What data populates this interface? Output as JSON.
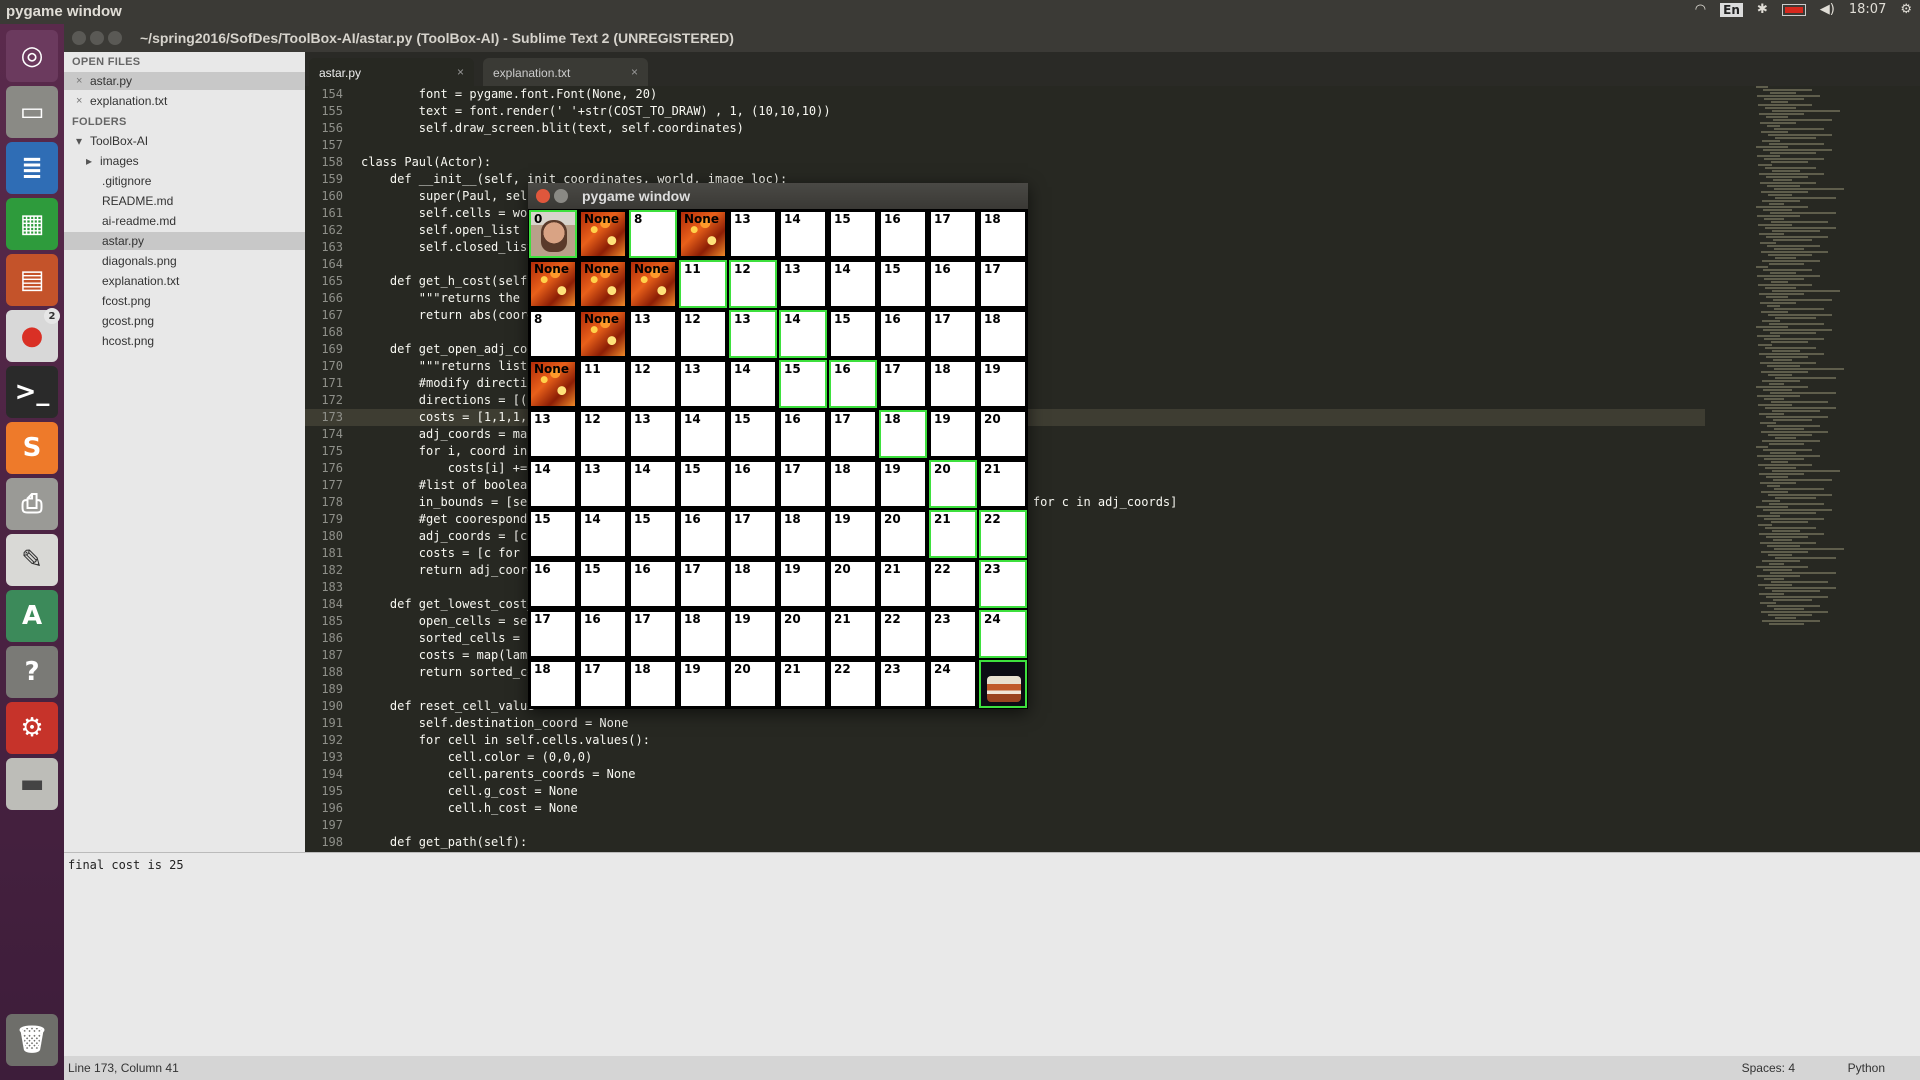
{
  "topbar": {
    "title": "pygame window",
    "lang": "En",
    "time": "18:07"
  },
  "launcher": {
    "chrome_badge": "2"
  },
  "window": {
    "title": "~/spring2016/SofDes/ToolBox-AI/astar.py (ToolBox-AI) - Sublime Text 2 (UNREGISTERED)"
  },
  "sidebar": {
    "open_files_header": "OPEN FILES",
    "open_files": [
      "astar.py",
      "explanation.txt"
    ],
    "folders_header": "FOLDERS",
    "root": "ToolBox-AI",
    "items": [
      "images",
      ".gitignore",
      "README.md",
      "ai-readme.md",
      "astar.py",
      "diagonals.png",
      "explanation.txt",
      "fcost.png",
      "gcost.png",
      "hcost.png"
    ]
  },
  "tabs": [
    {
      "label": "astar.py",
      "close": "×"
    },
    {
      "label": "explanation.txt",
      "close": "×"
    }
  ],
  "code": {
    "lines": [
      {
        "n": "154",
        "t": "        font = pygame.font.Font(None, 20)"
      },
      {
        "n": "155",
        "t": "        text = font.render(' '+str(COST_TO_DRAW) , 1, (10,10,10))"
      },
      {
        "n": "156",
        "t": "        self.draw_screen.blit(text, self.coordinates)"
      },
      {
        "n": "157",
        "t": ""
      },
      {
        "n": "158",
        "t": "class Paul(Actor):"
      },
      {
        "n": "159",
        "t": "    def __init__(self, init_coordinates, world, image_loc):"
      },
      {
        "n": "160",
        "t": "        super(Paul, self"
      },
      {
        "n": "161",
        "t": "        self.cells = wor"
      },
      {
        "n": "162",
        "t": "        self.open_list"
      },
      {
        "n": "163",
        "t": "        self.closed_list"
      },
      {
        "n": "164",
        "t": ""
      },
      {
        "n": "165",
        "t": "    def get_h_cost(self,"
      },
      {
        "n": "166",
        "t": "        \"\"\"returns the h"
      },
      {
        "n": "167",
        "t": "        return abs(coord"
      },
      {
        "n": "168",
        "t": ""
      },
      {
        "n": "169",
        "t": "    def get_open_adj_coo"
      },
      {
        "n": "170",
        "t": "        \"\"\"returns list                                                      closed list.\"\"\""
      },
      {
        "n": "171",
        "t": "        #modify directic"
      },
      {
        "n": "172",
        "t": "        directions = [(1                                                     (0,-2)]"
      },
      {
        "n": "173",
        "t": "        costs = [1,1,1,1"
      },
      {
        "n": "174",
        "t": "        adj_coords = map"
      },
      {
        "n": "175",
        "t": "        for i, coord in"
      },
      {
        "n": "176",
        "t": "            costs[i] +="
      },
      {
        "n": "177",
        "t": "        #list of boolean"
      },
      {
        "n": "178",
        "t": "        in_bounds = [sel                                                    self.closed_list for c in adj_coords]"
      },
      {
        "n": "179",
        "t": "        #get coorespondi"
      },
      {
        "n": "180",
        "t": "        adj_coords = [c"
      },
      {
        "n": "181",
        "t": "        costs = [c for ("
      },
      {
        "n": "182",
        "t": "        return adj_coord"
      },
      {
        "n": "183",
        "t": ""
      },
      {
        "n": "184",
        "t": "    def get_lowest_cost_"
      },
      {
        "n": "185",
        "t": "        open_cells = sel"
      },
      {
        "n": "186",
        "t": "        sorted_cells = s"
      },
      {
        "n": "187",
        "t": "        costs = map(lamb"
      },
      {
        "n": "188",
        "t": "        return sorted_ce"
      },
      {
        "n": "189",
        "t": ""
      },
      {
        "n": "190",
        "t": "    def reset_cell_value"
      },
      {
        "n": "191",
        "t": "        self.destination_coord = None"
      },
      {
        "n": "192",
        "t": "        for cell in self.cells.values():"
      },
      {
        "n": "193",
        "t": "            cell.color = (0,0,0)"
      },
      {
        "n": "194",
        "t": "            cell.parents_coords = None"
      },
      {
        "n": "195",
        "t": "            cell.g_cost = None"
      },
      {
        "n": "196",
        "t": "            cell.h_cost = None"
      },
      {
        "n": "197",
        "t": ""
      },
      {
        "n": "198",
        "t": "    def get_path(self):"
      }
    ]
  },
  "output": {
    "text": "final cost is 25"
  },
  "status": {
    "position": "Line 173, Column 41",
    "spaces": "Spaces: 4",
    "syntax": "Python"
  },
  "pygame": {
    "title": "pygame window",
    "grid": [
      [
        "0",
        "None",
        "8",
        "None",
        "13",
        "14",
        "15",
        "16",
        "17",
        "18"
      ],
      [
        "None",
        "None",
        "None",
        "11",
        "12",
        "13",
        "14",
        "15",
        "16",
        "17"
      ],
      [
        "8",
        "None",
        "13",
        "12",
        "13",
        "14",
        "15",
        "16",
        "17",
        "18"
      ],
      [
        "None",
        "11",
        "12",
        "13",
        "14",
        "15",
        "16",
        "17",
        "18",
        "19"
      ],
      [
        "13",
        "12",
        "13",
        "14",
        "15",
        "16",
        "17",
        "18",
        "19",
        "20"
      ],
      [
        "14",
        "13",
        "14",
        "15",
        "16",
        "17",
        "18",
        "19",
        "20",
        "21"
      ],
      [
        "15",
        "14",
        "15",
        "16",
        "17",
        "18",
        "19",
        "20",
        "21",
        "22"
      ],
      [
        "16",
        "15",
        "16",
        "17",
        "18",
        "19",
        "20",
        "21",
        "22",
        "23"
      ],
      [
        "17",
        "16",
        "17",
        "18",
        "19",
        "20",
        "21",
        "22",
        "23",
        "24"
      ],
      [
        "18",
        "17",
        "18",
        "19",
        "20",
        "21",
        "22",
        "23",
        "24",
        ""
      ]
    ],
    "lava_cells": [
      [
        0,
        1
      ],
      [
        0,
        3
      ],
      [
        1,
        0
      ],
      [
        1,
        1
      ],
      [
        1,
        2
      ],
      [
        2,
        1
      ],
      [
        3,
        0
      ]
    ],
    "green_cells": [
      [
        0,
        0
      ],
      [
        0,
        2
      ],
      [
        1,
        3
      ],
      [
        1,
        4
      ],
      [
        2,
        4
      ],
      [
        2,
        5
      ],
      [
        3,
        5
      ],
      [
        3,
        6
      ],
      [
        4,
        7
      ],
      [
        5,
        8
      ],
      [
        6,
        8
      ],
      [
        6,
        9
      ],
      [
        7,
        9
      ],
      [
        8,
        9
      ],
      [
        9,
        9
      ]
    ],
    "start_cell": [
      0,
      0
    ],
    "goal_cell": [
      9,
      9
    ]
  }
}
